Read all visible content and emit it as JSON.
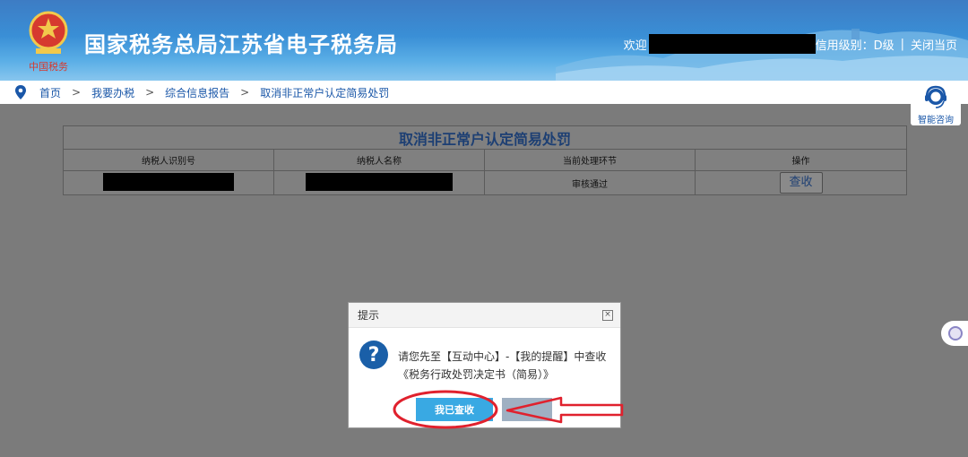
{
  "header": {
    "title": "国家税务总局江苏省电子税务局",
    "welcome_prefix": "欢迎",
    "credit_text": "信用级别：D级",
    "separator": "|",
    "close_label": "关闭当页",
    "emblem_text": "中国税务"
  },
  "breadcrumb": {
    "items": [
      "首页",
      "我要办税",
      "综合信息报告",
      "取消非正常户认定简易处罚"
    ],
    "separator": ">"
  },
  "consult": {
    "label": "智能咨询"
  },
  "table": {
    "title": "取消非正常户认定简易处罚",
    "columns": [
      "纳税人识别号",
      "纳税人名称",
      "当前处理环节",
      "操作"
    ],
    "rows": [
      {
        "status": "审核通过",
        "action": "查收"
      }
    ]
  },
  "dialog": {
    "title": "提示",
    "close_symbol": "×",
    "icon": "?",
    "message_line1": "请您先至【互动中心】-【我的提醒】中查收",
    "message_line2": "《税务行政处罚决定书（简易）》",
    "confirm_label": "我已查收"
  },
  "colors": {
    "header_blue": "#3a8fd6",
    "overlay_gray": "#7b7b7b",
    "confirm_button": "#39a9e3",
    "annotation_red": "#e0212d"
  }
}
